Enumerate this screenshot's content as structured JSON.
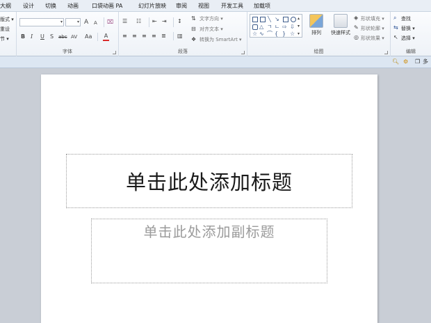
{
  "tabs": [
    "大纲",
    "设计",
    "切换",
    "动画",
    "口袋动画 PA",
    "幻灯片放映",
    "审阅",
    "视图",
    "开发工具",
    "加载项"
  ],
  "ribbon": {
    "slides_group": {
      "items": [
        "版式 ▾",
        "重设",
        "节 ▾"
      ]
    },
    "font_group": {
      "label": "字体",
      "grow": "A",
      "shrink": "A",
      "clear": "⌧",
      "bold": "B",
      "italic": "I",
      "underline": "U",
      "shadow": "S",
      "strike": "abc",
      "spacing": "AV",
      "case": "Aa",
      "color": "A"
    },
    "paragraph_group": {
      "label": "段落",
      "text_direction": "文字方向 ▾",
      "align_text": "对齐文本 ▾",
      "smartart": "转换为 SmartArt ▾"
    },
    "drawing_group": {
      "label": "绘图",
      "arrange": "排列",
      "quick_styles": "快速样式",
      "fill": "形状填充 ▾",
      "outline": "形状轮廓 ▾",
      "effects": "形状效果 ▾"
    },
    "editing_group": {
      "label": "编辑",
      "find": "查找",
      "replace": "替换 ▾",
      "select": "选择 ▾"
    }
  },
  "strip": {
    "more_label": "多"
  },
  "slide": {
    "title_placeholder": "单击此处添加标题",
    "subtitle_placeholder": "单击此处添加副标题"
  }
}
